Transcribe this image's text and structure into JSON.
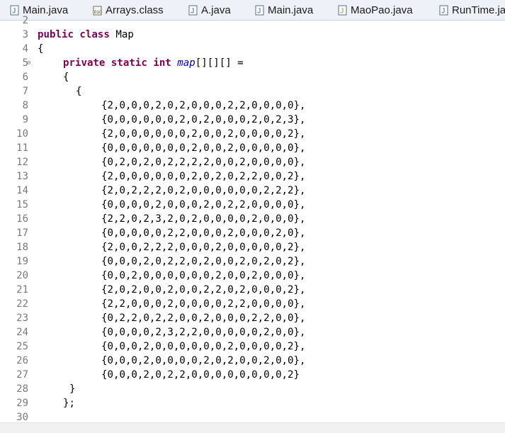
{
  "tabs": [
    {
      "label": "Main.java",
      "icon": "java-file-icon"
    },
    {
      "label": "Arrays.class",
      "icon": "class-file-icon"
    },
    {
      "label": "A.java",
      "icon": "java-file-icon"
    },
    {
      "label": "Main.java",
      "icon": "java-file-icon"
    },
    {
      "label": "MaoPao.java",
      "icon": "java-file-icon"
    },
    {
      "label": "RunTime.ja",
      "icon": "java-file-icon"
    }
  ],
  "editor": {
    "line_numbers": [
      "2",
      "3",
      "4",
      "5",
      "6",
      "7",
      "8",
      "9",
      "10",
      "11",
      "12",
      "13",
      "14",
      "15",
      "16",
      "17",
      "18",
      "19",
      "20",
      "21",
      "22",
      "23",
      "24",
      "25",
      "26",
      "27",
      "28",
      "29",
      "30"
    ],
    "lines": {
      "l3": {
        "kw1": "public",
        "kw2": "class",
        "rest": " Map"
      },
      "l4": "{",
      "l5": {
        "kw1": "private",
        "kw2": "static",
        "kw3": "int",
        "var": "map",
        "rest": "[][][] ="
      },
      "l6": "{",
      "l7": "{",
      "rows": [
        "{2,0,0,0,2,0,2,0,0,0,2,2,0,0,0,0},",
        "{0,0,0,0,0,0,2,0,2,0,0,0,2,0,2,3},",
        "{2,0,0,0,0,0,0,2,0,0,2,0,0,0,0,2},",
        "{0,0,0,0,0,0,0,2,0,0,2,0,0,0,0,0},",
        "{0,2,0,2,0,2,2,2,2,0,0,2,0,0,0,0},",
        "{2,0,0,0,0,0,0,2,0,2,0,2,2,0,0,2},",
        "{2,0,2,2,2,0,2,0,0,0,0,0,0,2,2,2},",
        "{0,0,0,0,2,0,0,0,2,0,2,2,0,0,0,0},",
        "{2,2,0,2,3,2,0,2,0,0,0,0,2,0,0,0},",
        "{0,0,0,0,0,2,2,0,0,0,2,0,0,0,2,0},",
        "{2,0,0,2,2,2,0,0,0,2,0,0,0,0,0,2},",
        "{0,0,0,2,0,2,2,0,2,0,0,2,0,2,0,2},",
        "{0,0,2,0,0,0,0,0,0,2,0,0,2,0,0,0},",
        "{2,0,2,0,0,2,0,0,2,2,0,2,0,0,0,2},",
        "{2,2,0,0,0,2,0,0,0,0,2,2,0,0,0,0},",
        "{0,2,2,0,2,2,0,0,2,0,0,0,2,2,0,0},",
        "{0,0,0,0,2,3,2,2,0,0,0,0,0,2,0,0},",
        "{0,0,0,2,0,0,0,0,0,0,2,0,0,0,0,2},",
        "{0,0,0,2,0,0,0,0,2,0,2,0,0,2,0,0},",
        "{0,0,0,2,0,2,2,0,0,0,0,0,0,0,0,2}"
      ],
      "l28": "}",
      "l29": "};"
    }
  },
  "colors": {
    "keyword": "#7f0055",
    "field": "#0000c0",
    "tab_bg": "#eef2f8"
  }
}
